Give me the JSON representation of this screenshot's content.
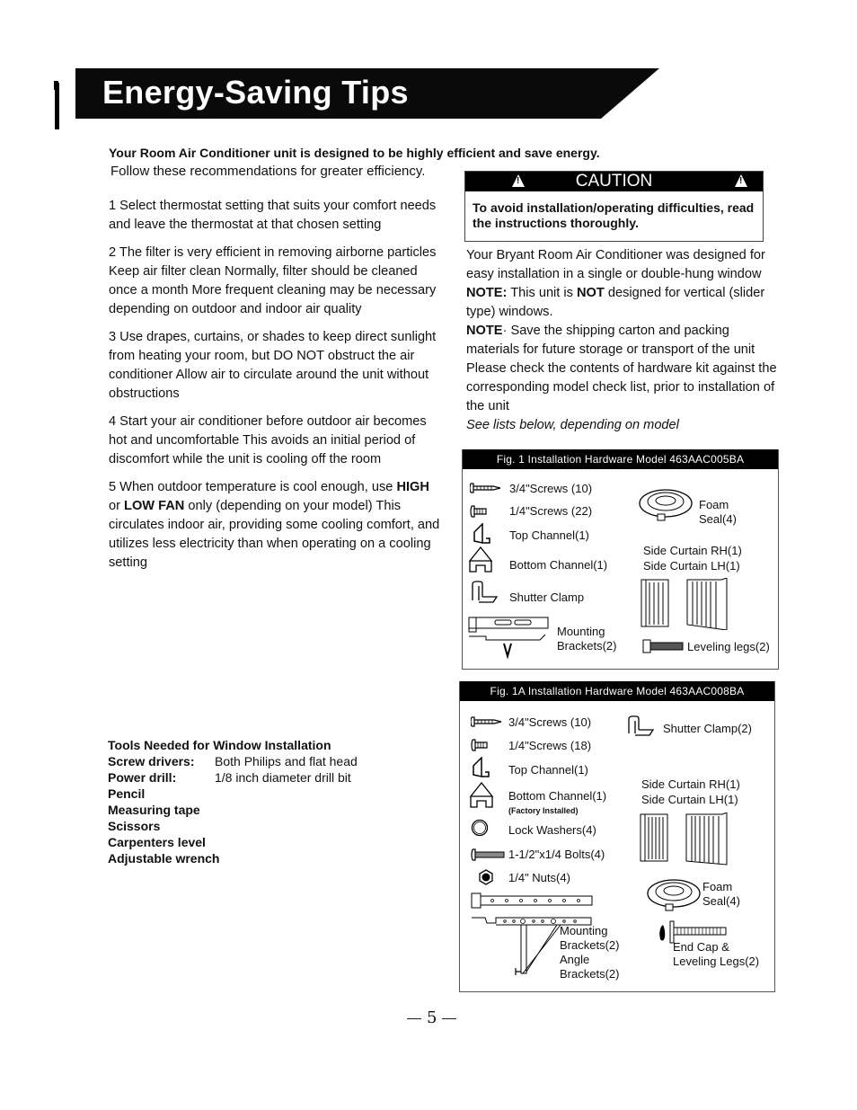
{
  "header": {
    "title": "Energy-Saving Tips"
  },
  "intro": {
    "bold": "Your Room Air Conditioner unit is designed to be highly efficient and save energy.",
    "plain": "Follow these recommendations for greater efficiency."
  },
  "tips": [
    {
      "text": "1  Select thermostat setting that suits your comfort needs and leave the thermostat at that chosen setting"
    },
    {
      "text": "2  The filter is very efficient in removing airborne particles  Keep air filter clean  Normally, filter should be cleaned once a month  More frequent cleaning may be necessary depending on outdoor and indoor air quality"
    },
    {
      "text": "3   Use drapes, curtains, or shades to keep direct sunlight from heating your room, but DO NOT obstruct the air conditioner  Allow air to circulate around the unit without obstructions"
    },
    {
      "text": "4  Start your air conditioner before outdoor air becomes hot and uncomfortable  This avoids an initial period of discomfort while the unit is cooling off the room"
    },
    {
      "pre": "5  When outdoor temperature is cool enough, use ",
      "bold1": "HIGH",
      "mid": " or ",
      "bold2": "LOW FAN",
      "post": " only (depending on your model)  This circulates indoor air, providing some cooling comfort, and utilizes less electricity than when operating on a cooling setting"
    }
  ],
  "tools": {
    "heading": "Tools Needed for Window Installation",
    "rows": [
      {
        "label": "Screw drivers:",
        "value": "Both  Philips  and flat head"
      },
      {
        "label": "Power drill:",
        "value": "1/8 inch  diameter  drill  bit"
      }
    ],
    "items": [
      "Pencil",
      "Measuring tape",
      "Scissors",
      "Carpenters level",
      "Adjustable wrench"
    ]
  },
  "caution": {
    "label": "CAUTION",
    "icon": "warning-triangle-icon",
    "body": "To avoid installation/operating difficulties, read the instructions thoroughly."
  },
  "installation": {
    "p1": "Your Bryant Room Air Conditioner was designed for easy installation in a single or double-hung window ",
    "note1_label": "NOTE:",
    "note1_a": " This unit is ",
    "note1_not": "NOT",
    "note1_b": " designed for vertical (slider type) windows.",
    "note2_label": "NOTE",
    "note2": "· Save the shipping carton and packing materials for future storage or transport of the unit  Please check the contents of hardware kit against the corresponding model check list, prior to installation of the unit",
    "italic": "See lists below, depending on model"
  },
  "fig1": {
    "title": "Fig. 1 Installation Hardware Model 463AAC005BA",
    "items": {
      "screws34": "3/4\"Screws (10)",
      "screws14": "1/4\"Screws (22)",
      "top_channel": "Top Channel(1)",
      "bottom_channel": "Bottom Channel(1)",
      "shutter_clamp": "Shutter Clamp",
      "mounting_brackets_1": "Mounting",
      "mounting_brackets_2": "Brackets(2)",
      "foam_1": "Foam",
      "foam_2": "Seal(4)",
      "side_rh": "Side Curtain RH(1)",
      "side_lh": "Side Curtain LH(1)",
      "leveling": "Leveling legs(2)"
    }
  },
  "fig1a": {
    "title": "Fig. 1A Installation Hardware Model 463AAC008BA",
    "items": {
      "screws34": "3/4\"Screws (10)",
      "screws14": "1/4\"Screws (18)",
      "top_channel": "Top Channel(1)",
      "bottom_channel": "Bottom Channel(1)",
      "factory": "(Factory Installed)",
      "lock_washers": "Lock Washers(4)",
      "bolts": "1-1/2\"x1/4 Bolts(4)",
      "nuts": "1/4\" Nuts(4)",
      "mounting_1": "Mounting",
      "mounting_2": "Brackets(2)",
      "angle_1": "Angle",
      "angle_2": "Brackets(2)",
      "shutter_clamp": "Shutter Clamp(2)",
      "side_rh": "Side Curtain RH(1)",
      "side_lh": "Side Curtain LH(1)",
      "foam_1": "Foam",
      "foam_2": "Seal(4)",
      "endcap_1": "End Cap &",
      "endcap_2": "Leveling Legs(2)"
    }
  },
  "footer": {
    "page_number": "5"
  }
}
